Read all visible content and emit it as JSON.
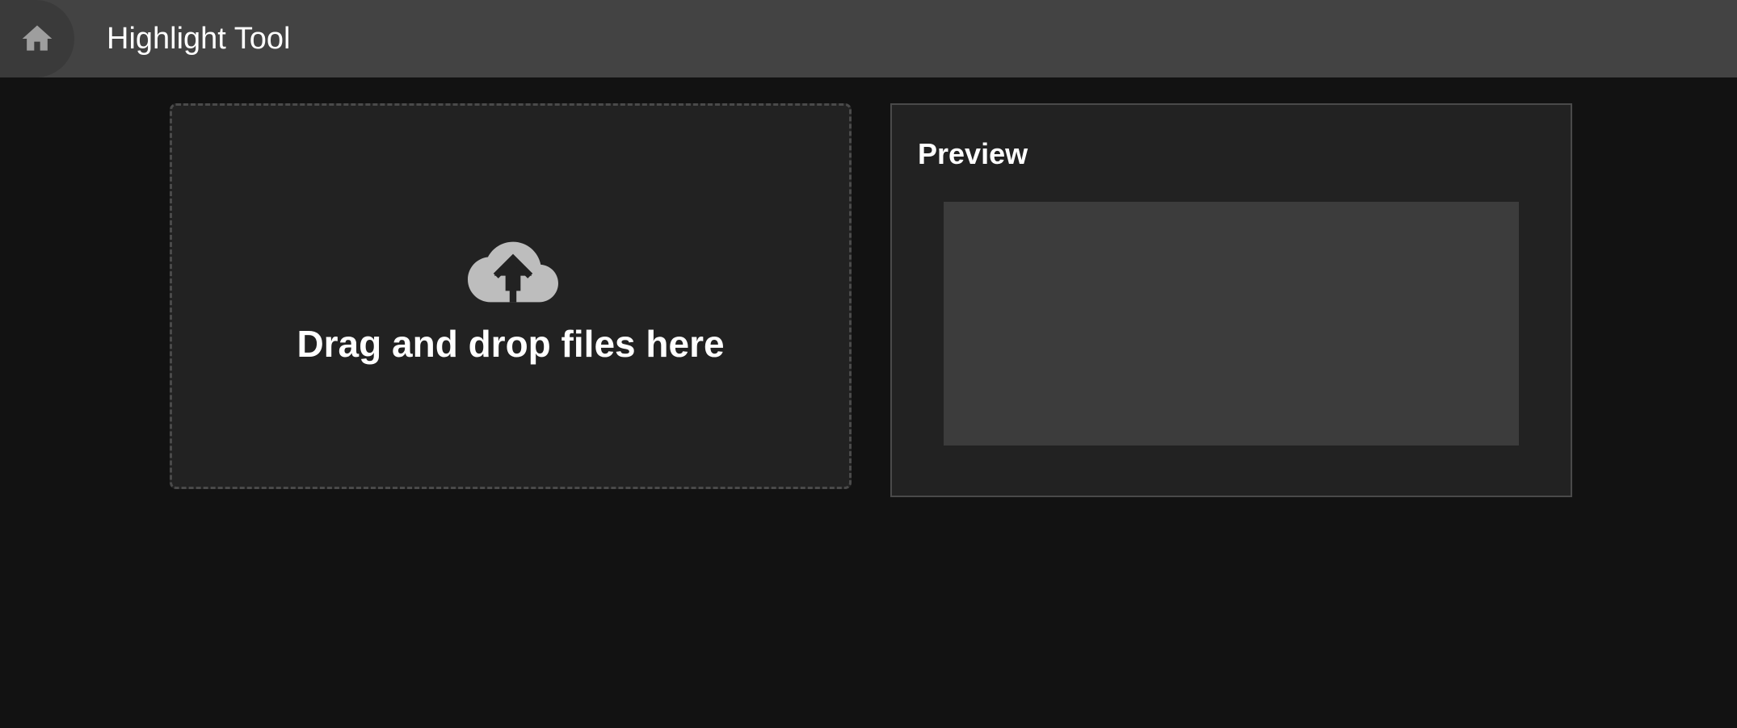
{
  "app": {
    "title": "Highlight Tool",
    "home_icon": "home-icon"
  },
  "dropzone": {
    "icon": "cloud-upload-icon",
    "text": "Drag and drop files here"
  },
  "preview": {
    "title": "Preview"
  },
  "colors": {
    "appbar_bg": "#434343",
    "page_bg": "#121212",
    "panel_bg": "#222222",
    "preview_box_bg": "#3c3c3c",
    "icon_gray": "#bdbdbd"
  }
}
